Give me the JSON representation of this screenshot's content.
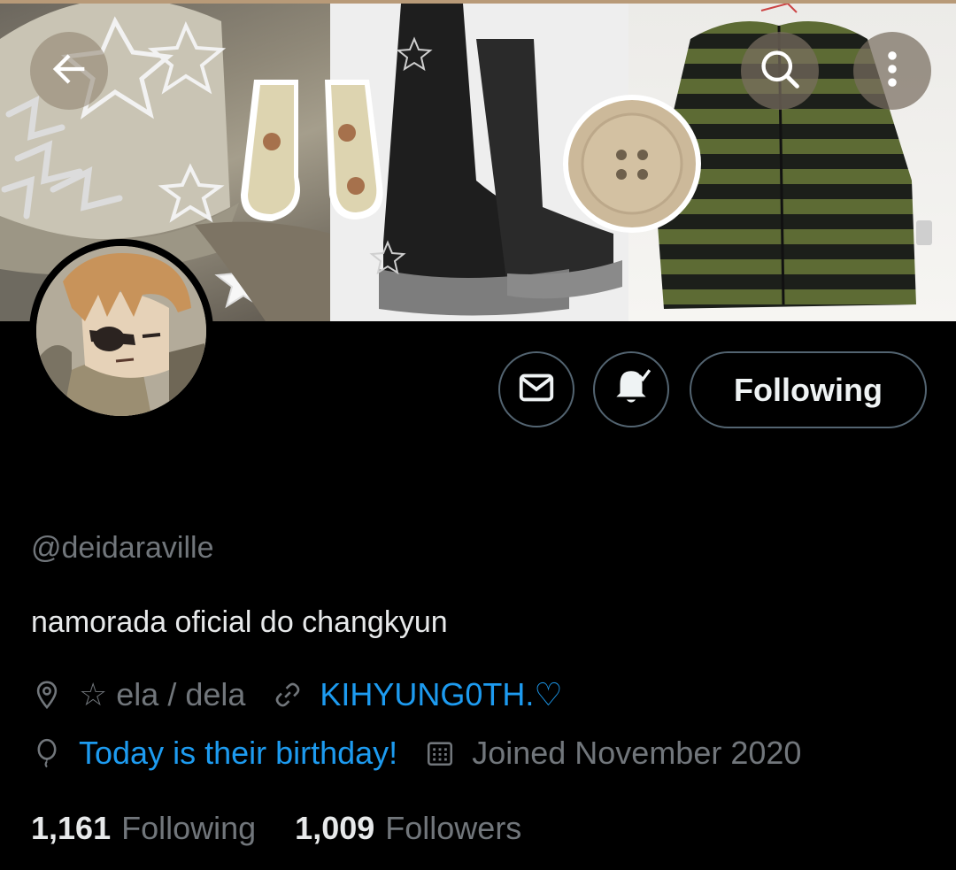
{
  "header": {
    "back_icon": "arrow-left-icon",
    "search_icon": "search-icon",
    "more_icon": "more-vertical-icon"
  },
  "profile": {
    "handle": "@deidaraville",
    "bio": "namorada oficial do changkyun",
    "location": "☆ ela / dela",
    "website": "KIHYUNG0TH.♡",
    "birthday": "Today is their birthday!",
    "joined": "Joined November 2020"
  },
  "actions": {
    "message_icon": "envelope-icon",
    "notify_icon": "bell-check-icon",
    "following_label": "Following"
  },
  "stats": {
    "following_count": "1,161",
    "following_label": "Following",
    "followers_count": "1,009",
    "followers_label": "Followers"
  },
  "colors": {
    "background": "#000000",
    "text_primary": "#e7e9ea",
    "text_secondary": "#71767b",
    "link": "#1d9bf0",
    "border": "#536471"
  }
}
